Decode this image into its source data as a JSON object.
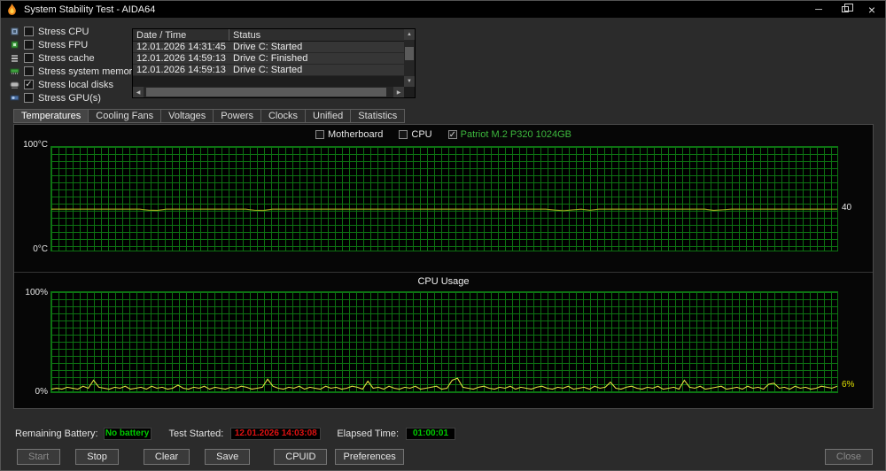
{
  "window": {
    "title": "System Stability Test - AIDA64"
  },
  "icons": {
    "check": "✓",
    "scroll_up": "▲",
    "scroll_down": "▼",
    "scroll_left": "◀",
    "scroll_right": "▶",
    "minimize": "─",
    "close": "×"
  },
  "stress_options": {
    "items": [
      {
        "label": "Stress CPU",
        "checked": false
      },
      {
        "label": "Stress FPU",
        "checked": false
      },
      {
        "label": "Stress cache",
        "checked": false
      },
      {
        "label": "Stress system memory",
        "checked": false
      },
      {
        "label": "Stress local disks",
        "checked": true
      },
      {
        "label": "Stress GPU(s)",
        "checked": false
      }
    ]
  },
  "log": {
    "columns": [
      "Date / Time",
      "Status"
    ],
    "rows": [
      {
        "datetime": "12.01.2026 14:31:45",
        "status": "Drive C: Started"
      },
      {
        "datetime": "12.01.2026 14:59:13",
        "status": "Drive C: Finished"
      },
      {
        "datetime": "12.01.2026 14:59:13",
        "status": "Drive C: Started"
      }
    ]
  },
  "tabs": {
    "items": [
      "Temperatures",
      "Cooling Fans",
      "Voltages",
      "Powers",
      "Clocks",
      "Unified",
      "Statistics"
    ],
    "active": "Temperatures"
  },
  "legend": {
    "items": [
      {
        "label": "Motherboard",
        "checked": false,
        "color": "#e6e6e6"
      },
      {
        "label": "CPU",
        "checked": false,
        "color": "#e6e6e6"
      },
      {
        "label": "Patriot M.2 P320 1024GB",
        "checked": true,
        "color": "#3db83d"
      }
    ]
  },
  "chart_data": [
    {
      "type": "line",
      "svg_id": "temp-line",
      "title": "Temperatures",
      "ylim": [
        0,
        100
      ],
      "y_top": "100°C",
      "y_bottom": "0°C",
      "current_label": "40",
      "current_label_color": "#e8e8e8",
      "line_color": "#b4b41e",
      "grid_color": "#0d7212",
      "legend_position": "top-center",
      "series": [
        {
          "name": "Patriot M.2 P320 1024GB",
          "values": [
            40,
            40,
            40,
            40,
            40,
            40,
            40,
            40,
            40,
            40,
            40,
            39.1,
            38.8,
            40,
            40,
            40,
            40,
            40,
            40,
            40,
            40,
            40,
            40,
            39,
            38.7,
            40,
            40,
            40,
            40,
            40,
            40,
            40,
            40,
            40,
            40,
            40,
            40,
            40,
            40,
            40,
            40,
            40,
            40,
            40,
            40,
            40,
            40,
            40,
            40,
            40,
            40,
            40,
            40,
            40,
            40,
            40,
            40,
            39.2,
            38.6,
            39.3,
            40,
            39,
            40,
            40,
            40,
            40,
            40,
            40,
            40,
            40,
            40,
            40,
            40,
            40,
            40,
            38.8,
            39.4,
            40,
            40,
            40,
            40,
            40,
            40,
            40,
            40,
            40,
            40,
            40,
            40,
            40
          ]
        }
      ]
    },
    {
      "type": "line",
      "svg_id": "cpu-line",
      "title": "CPU Usage",
      "ylim": [
        0,
        100
      ],
      "y_top": "100%",
      "y_bottom": "0%",
      "current_label": "6%",
      "current_label_color": "#e0e000",
      "line_color": "#e0e040",
      "grid_color": "#0d7212",
      "series": [
        {
          "name": "CPU Usage",
          "values": [
            3,
            4,
            3,
            5,
            4,
            3,
            6,
            4,
            12,
            5,
            4,
            3,
            5,
            4,
            6,
            3,
            4,
            5,
            3,
            6,
            4,
            5,
            3,
            4,
            7,
            4,
            3,
            5,
            4,
            6,
            3,
            5,
            4,
            3,
            5,
            4,
            6,
            5,
            3,
            4,
            5,
            13,
            6,
            4,
            3,
            5,
            4,
            6,
            3,
            5,
            4,
            3,
            6,
            4,
            5,
            3,
            4,
            6,
            5,
            3,
            11,
            4,
            5,
            3,
            6,
            4,
            3,
            5,
            4,
            6,
            3,
            4,
            5,
            6,
            3,
            4,
            12,
            14,
            5,
            4,
            3,
            5,
            6,
            4,
            3,
            5,
            4,
            6,
            3,
            5,
            4,
            3,
            5,
            6,
            4,
            3,
            5,
            4,
            6,
            3,
            4,
            5,
            3,
            6,
            4,
            5,
            10,
            4,
            3,
            5,
            6,
            4,
            3,
            5,
            4,
            6,
            3,
            4,
            5,
            3,
            12,
            5,
            4,
            6,
            3,
            4,
            5,
            6,
            3,
            4,
            5,
            3,
            6,
            4,
            5,
            3,
            8,
            9,
            4,
            5,
            3,
            6,
            4,
            5,
            3,
            4,
            6,
            5,
            4,
            6
          ]
        }
      ]
    }
  ],
  "status_bar": {
    "battery_label": "Remaining Battery:",
    "battery_value": "No battery",
    "battery_color": "#00cc00",
    "started_label": "Test Started:",
    "started_value": "12.01.2026 14:03:08",
    "started_color": "#dd1111",
    "elapsed_label": "Elapsed Time:",
    "elapsed_value": "01:00:01",
    "elapsed_color": "#00cc00"
  },
  "actions": {
    "start": "Start",
    "stop": "Stop",
    "clear": "Clear",
    "save": "Save",
    "cpuid": "CPUID",
    "preferences": "Preferences",
    "close": "Close"
  }
}
